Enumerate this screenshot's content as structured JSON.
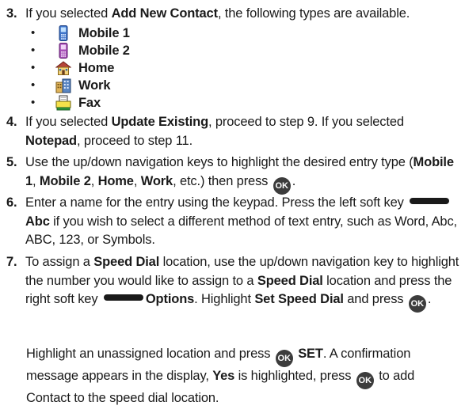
{
  "step3": {
    "number": "3.",
    "text_before": "If you selected ",
    "bold": "Add New Contact",
    "text_after": ", the following types are available.",
    "types": [
      {
        "bullet": "•",
        "label": "Mobile 1",
        "icon": "mobile-phone-blue-icon"
      },
      {
        "bullet": "•",
        "label": "Mobile 2",
        "icon": "mobile-phone-purple-icon"
      },
      {
        "bullet": "•",
        "label": "Home",
        "icon": "house-icon"
      },
      {
        "bullet": "•",
        "label": "Work",
        "icon": "office-building-icon"
      },
      {
        "bullet": "•",
        "label": "Fax",
        "icon": "fax-machine-icon"
      }
    ]
  },
  "step4": {
    "number": "4.",
    "t1": "If you selected ",
    "b1": "Update Existing",
    "t2": ", proceed to step 9. If you selected ",
    "b2": "Notepad",
    "t3": ", proceed to step 11."
  },
  "step5": {
    "number": "5.",
    "t1": "Use the up/down navigation keys to highlight the desired entry type (",
    "b1": "Mobile 1",
    "s1": ", ",
    "b2": "Mobile 2",
    "s2": ", ",
    "b3": "Home",
    "s3": ", ",
    "b4": "Work",
    "t2": ", etc.) then press ",
    "ok": "OK",
    "t3": "."
  },
  "step6": {
    "number": "6.",
    "t1": "Enter a name for the entry using the keypad. Press the left soft key ",
    "b1": "Abc",
    "t2": " if you wish to select a different method of text entry, such as Word, Abc, ABC, 123, or Symbols."
  },
  "step7": {
    "number": "7.",
    "t1": "To assign a ",
    "b1": "Speed Dial",
    "t2": " location, use the up/down navigation key to highlight the number you would like to assign to a ",
    "b2": "Speed Dial",
    "t3": " location and press the right soft key ",
    "b3": "Options",
    "t4": ". Highlight ",
    "b4": "Set Speed Dial",
    "t5": " and press ",
    "ok": "OK",
    "t6": ".",
    "para2": {
      "t1": "Highlight an unassigned location and press ",
      "ok1": "OK",
      "b1": "SET",
      "t2": ". A confirmation message appears in the display, ",
      "b2": "Yes",
      "t3": " is highlighted, press ",
      "ok2": "OK",
      "t4": " to add Contact to the speed dial location."
    }
  }
}
